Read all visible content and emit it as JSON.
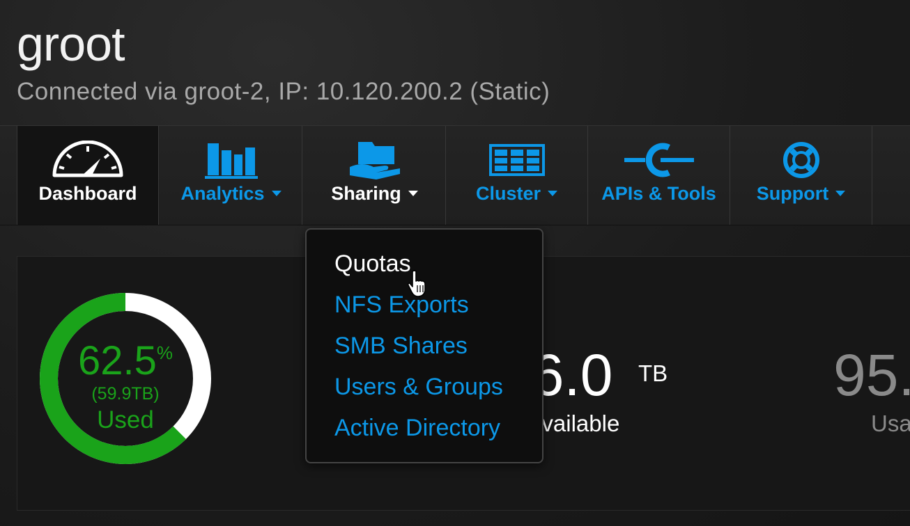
{
  "header": {
    "cluster_name": "groot",
    "connection": "Connected via groot-2, IP: 10.120.200.2 (Static)"
  },
  "nav": {
    "items": [
      {
        "label": "Dashboard",
        "icon": "gauge-icon",
        "active": true,
        "dropdown": false
      },
      {
        "label": "Analytics",
        "icon": "bar-chart-icon",
        "active": false,
        "dropdown": true
      },
      {
        "label": "Sharing",
        "icon": "folder-hand-icon",
        "active": false,
        "dropdown": true
      },
      {
        "label": "Cluster",
        "icon": "rack-grid-icon",
        "active": false,
        "dropdown": true
      },
      {
        "label": "APIs & Tools",
        "icon": "connector-icon",
        "active": false,
        "dropdown": false
      },
      {
        "label": "Support",
        "icon": "lifebuoy-icon",
        "active": false,
        "dropdown": true
      }
    ]
  },
  "dropdown": {
    "items": [
      "Quotas",
      "NFS Exports",
      "SMB Shares",
      "Users & Groups",
      "Active Directory"
    ],
    "hovered": "Quotas"
  },
  "capacity": {
    "used_percent_value": 62.5,
    "used_percent": "62.5",
    "percent_sign": "%",
    "used_tb": "(59.9TB)",
    "used_label": "Used",
    "available_value": "36.0",
    "available_unit": "TB",
    "available_label": "Available",
    "usable_value": "95.",
    "usable_label": "Usa"
  },
  "colors": {
    "accent_blue": "#0c98e8",
    "used_green": "#1aa31a",
    "background": "#1c1c1c"
  }
}
